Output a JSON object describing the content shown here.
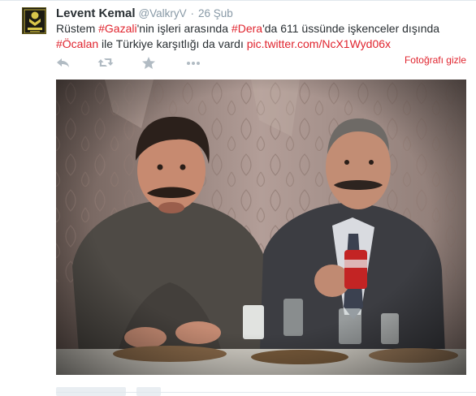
{
  "tweet": {
    "author_name": "Levent Kemal",
    "handle": "@ValkryV",
    "separator": "·",
    "time": "26 Şub",
    "text": {
      "t1": "Rüstem ",
      "hash1_symbol": "#",
      "hash1_word": "Gazali",
      "t2": "'nin işleri arasında ",
      "hash2_symbol": "#",
      "hash2_word": "Dera",
      "t3": "'da 611 üssünde işkenceler dışında ",
      "hash3_symbol": "#",
      "hash3_word": "Öcalan",
      "t4": " ile Türkiye karşıtlığı da vardı ",
      "link": "pic.twitter.com/NcX1Wyd06x"
    },
    "hide_photo_label": "Fotoğrafı gizle",
    "actions": [
      "reply-icon",
      "retweet-icon",
      "favorite-icon",
      "more-icon"
    ]
  },
  "colors": {
    "accent": "#e0242e",
    "name": "#292f33",
    "muted": "#8899a6",
    "icon": "#b1bbc3"
  }
}
